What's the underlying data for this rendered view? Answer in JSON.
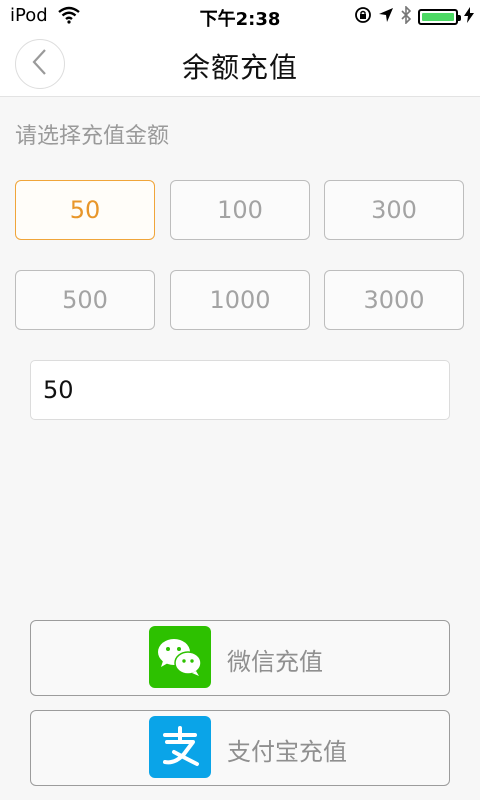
{
  "status_bar": {
    "carrier": "iPod",
    "time": "下午2:38",
    "battery_level": 1.0
  },
  "navbar": {
    "title": "余额充值",
    "back_icon": "chevron-left-icon"
  },
  "amount_section": {
    "label": "请选择充值金额",
    "options": [
      "50",
      "100",
      "300",
      "500",
      "1000",
      "3000"
    ],
    "selected": "50"
  },
  "amount_input": {
    "value": "50"
  },
  "payment": {
    "wechat_label": "微信充值",
    "alipay_label": "支付宝充值"
  },
  "colors": {
    "accent": "#e8962a",
    "wechat_green": "#2dc100",
    "alipay_blue": "#0aa4e8",
    "battery_green": "#4cd964"
  }
}
